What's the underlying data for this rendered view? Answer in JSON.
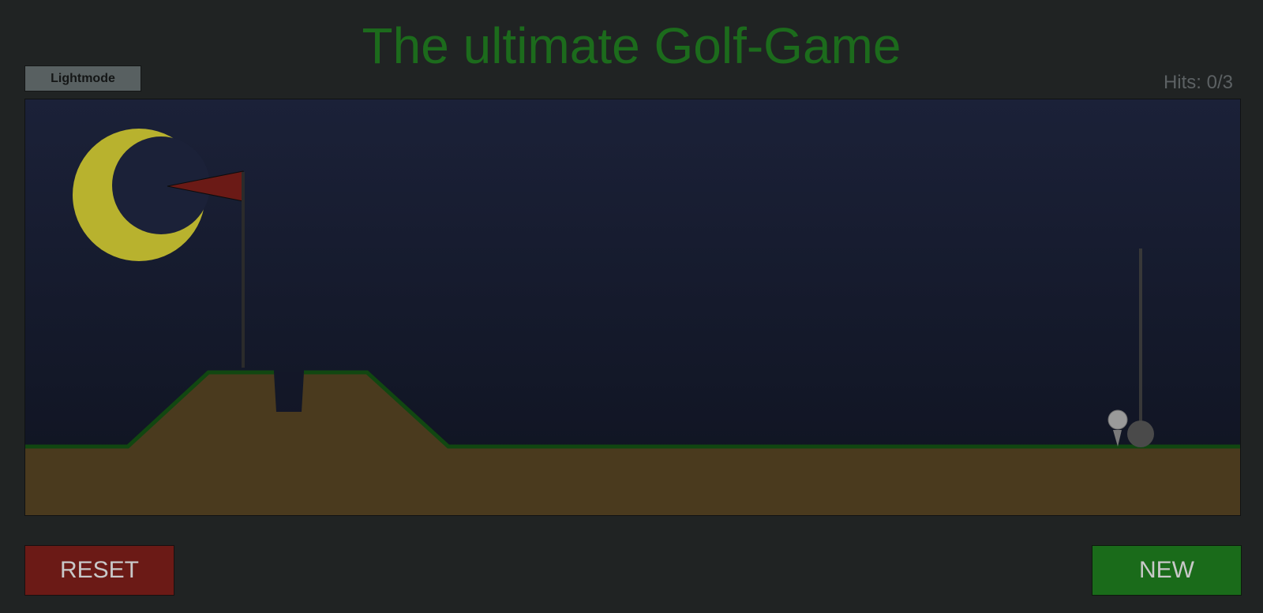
{
  "header": {
    "title": "The ultimate Golf-Game",
    "mode_button_label": "Lightmode"
  },
  "score": {
    "hits_text": "Hits: 0/3",
    "hits": 0,
    "max_hits": 3
  },
  "controls": {
    "reset_label": "RESET",
    "new_label": "NEW"
  },
  "colors": {
    "title": "#1c6b1c",
    "sky_top": "#1b2138",
    "sky_bottom": "#0f1320",
    "moon": "#b8b22e",
    "flag": "#6b1a16",
    "ground": "#4a3a1e",
    "grass": "#114711",
    "ball": "#9a9a9a",
    "club": "#4a4a4a",
    "reset_button": "#6b1a16",
    "new_button": "#1a6b1a"
  },
  "icons": {
    "moon": "crescent-moon-icon",
    "flag": "pennant-flag-icon"
  }
}
